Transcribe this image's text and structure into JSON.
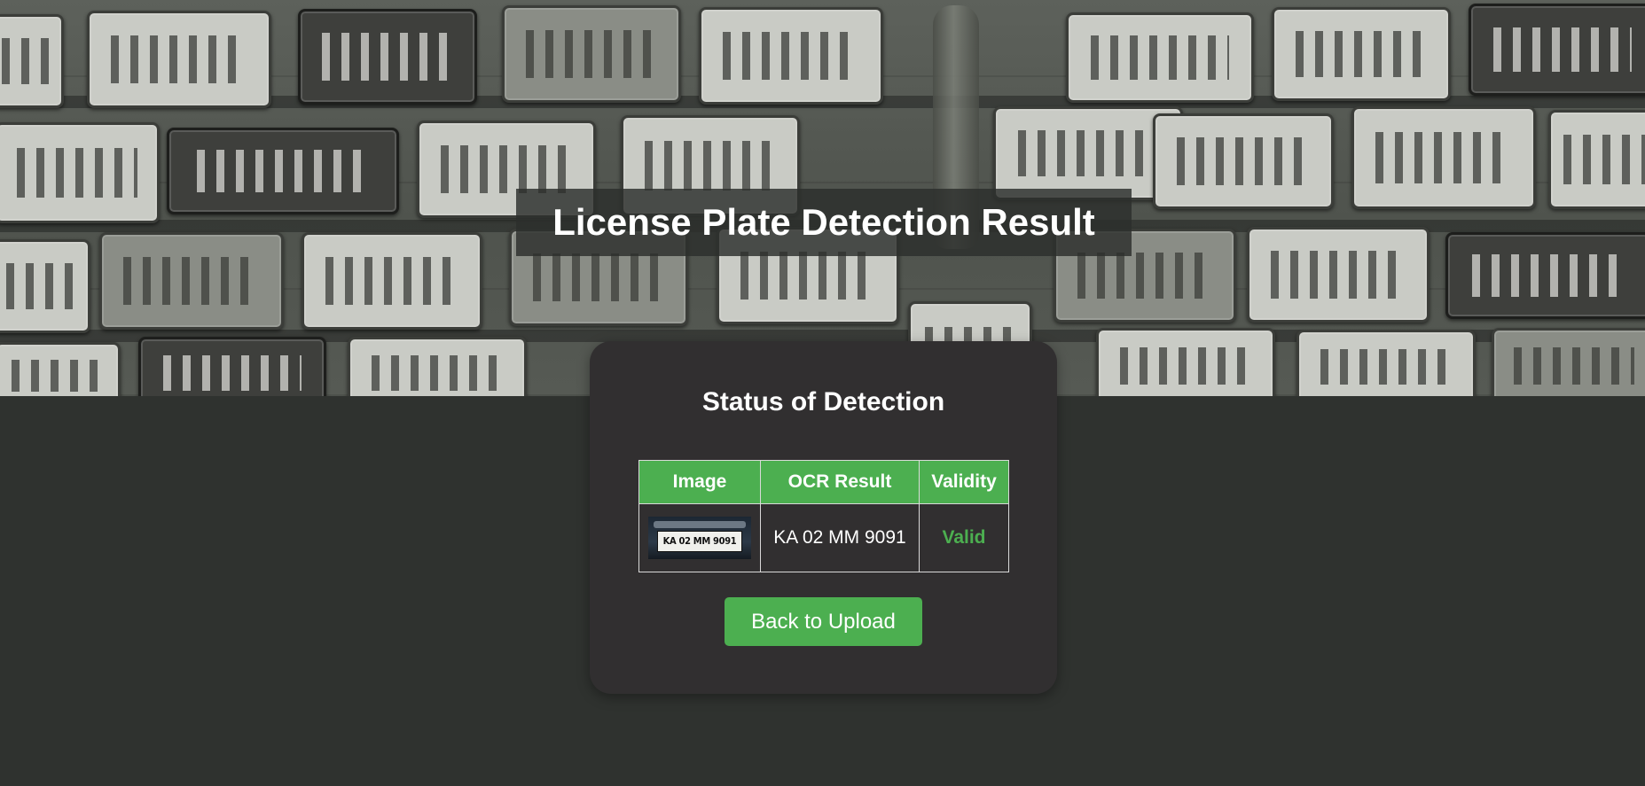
{
  "header": {
    "title": "License Plate Detection Result"
  },
  "card": {
    "title": "Status of Detection",
    "table": {
      "columns": [
        "Image",
        "OCR Result",
        "Validity"
      ],
      "rows": [
        {
          "image_plate_text": "KA 02 MM 9091",
          "ocr_result": "KA 02 MM 9091",
          "validity": "Valid"
        }
      ]
    },
    "back_button_label": "Back to Upload"
  },
  "colors": {
    "accent": "#4caf50",
    "page_background": "#2f322f",
    "card_background": "#312f30",
    "valid_status": "#4caf50"
  }
}
